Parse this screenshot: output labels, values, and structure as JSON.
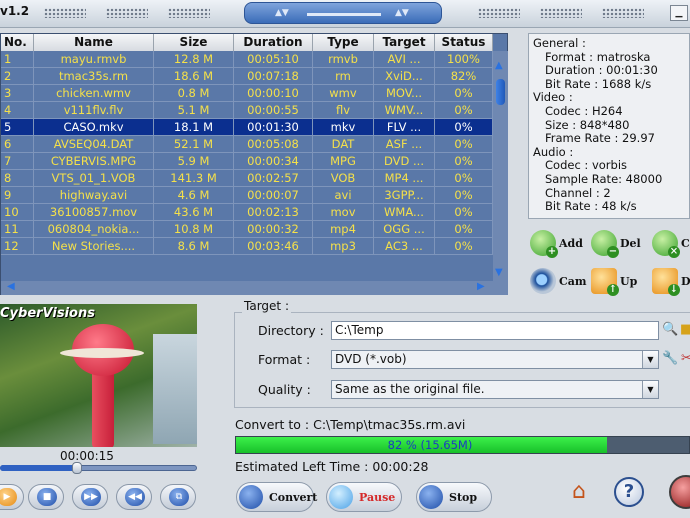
{
  "app": {
    "version": "v1.2"
  },
  "list": {
    "columns": [
      "No.",
      "Name",
      "Size",
      "Duration",
      "Type",
      "Target",
      "Status"
    ],
    "rows": [
      [
        "1",
        "mayu.rmvb",
        "12.8 M",
        "00:05:10",
        "rmvb",
        "AVI ...",
        "100%"
      ],
      [
        "2",
        "tmac35s.rm",
        "18.6 M",
        "00:07:18",
        "rm",
        "XviD...",
        "82%"
      ],
      [
        "3",
        "chicken.wmv",
        "0.8 M",
        "00:00:10",
        "wmv",
        "MOV...",
        "0%"
      ],
      [
        "4",
        "v111flv.flv",
        "5.1 M",
        "00:00:55",
        "flv",
        "WMV...",
        "0%"
      ],
      [
        "5",
        "CASO.mkv",
        "18.1 M",
        "00:01:30",
        "mkv",
        "FLV ...",
        "0%"
      ],
      [
        "6",
        "AVSEQ04.DAT",
        "52.1 M",
        "00:05:08",
        "DAT",
        "ASF ...",
        "0%"
      ],
      [
        "7",
        "CYBERVIS.MPG",
        "5.9 M",
        "00:00:34",
        "MPG",
        "DVD ...",
        "0%"
      ],
      [
        "8",
        "VTS_01_1.VOB",
        "141.3 M",
        "00:02:57",
        "VOB",
        "MP4 ...",
        "0%"
      ],
      [
        "9",
        "highway.avi",
        "4.6 M",
        "00:00:07",
        "avi",
        "3GPP...",
        "0%"
      ],
      [
        "10",
        "36100857.mov",
        "43.6 M",
        "00:02:13",
        "mov",
        "WMA...",
        "0%"
      ],
      [
        "11",
        "060804_nokia...",
        "10.8 M",
        "00:00:32",
        "mp4",
        "OGG ...",
        "0%"
      ],
      [
        "12",
        "New Stories....",
        "8.6 M",
        "00:03:46",
        "mp3",
        "AC3 ...",
        "0%"
      ]
    ],
    "selected_index": 4
  },
  "info": [
    {
      "text": "General :",
      "indent": false
    },
    {
      "text": "Format : matroska",
      "indent": true
    },
    {
      "text": "Duration : 00:01:30",
      "indent": true
    },
    {
      "text": "Bit Rate : 1688 k/s",
      "indent": true
    },
    {
      "text": "Video :",
      "indent": false
    },
    {
      "text": "Codec : H264",
      "indent": true
    },
    {
      "text": "Size : 848*480",
      "indent": true
    },
    {
      "text": "Frame Rate : 29.97",
      "indent": true
    },
    {
      "text": "Audio :",
      "indent": false
    },
    {
      "text": "Codec : vorbis",
      "indent": true
    },
    {
      "text": "Sample Rate: 48000",
      "indent": true
    },
    {
      "text": "Channel : 2",
      "indent": true
    },
    {
      "text": "Bit Rate : 48 k/s",
      "indent": true
    }
  ],
  "actions": {
    "add": "Add",
    "del": "Del",
    "clear": "Cl",
    "cam": "Cam",
    "up": "Up",
    "down": "Do"
  },
  "preview": {
    "brand": "CyberVisions",
    "time": "00:00:15",
    "seek_fraction": 0.39
  },
  "target": {
    "legend": "Target :",
    "directory_label": "Directory :",
    "directory_value": "C:\\Temp",
    "format_label": "Format :",
    "format_value": "DVD (*.vob)",
    "quality_label": "Quality :",
    "quality_value": "Same as the original file."
  },
  "convert_to": "Convert to : C:\\Temp\\tmac35s.rm.avi",
  "progress": {
    "text": "82 %  (15.65M)",
    "fraction": 0.82
  },
  "eta": "Estimated Left Time : 00:00:28",
  "buttons": {
    "convert": "Convert",
    "pause": "Pause",
    "stop": "Stop",
    "help": "?"
  },
  "colors": {
    "list_bg": "#5a78a8",
    "list_text": "#f4e04a",
    "selected_row": "#0b2f8f",
    "progress": "#18c02a"
  }
}
